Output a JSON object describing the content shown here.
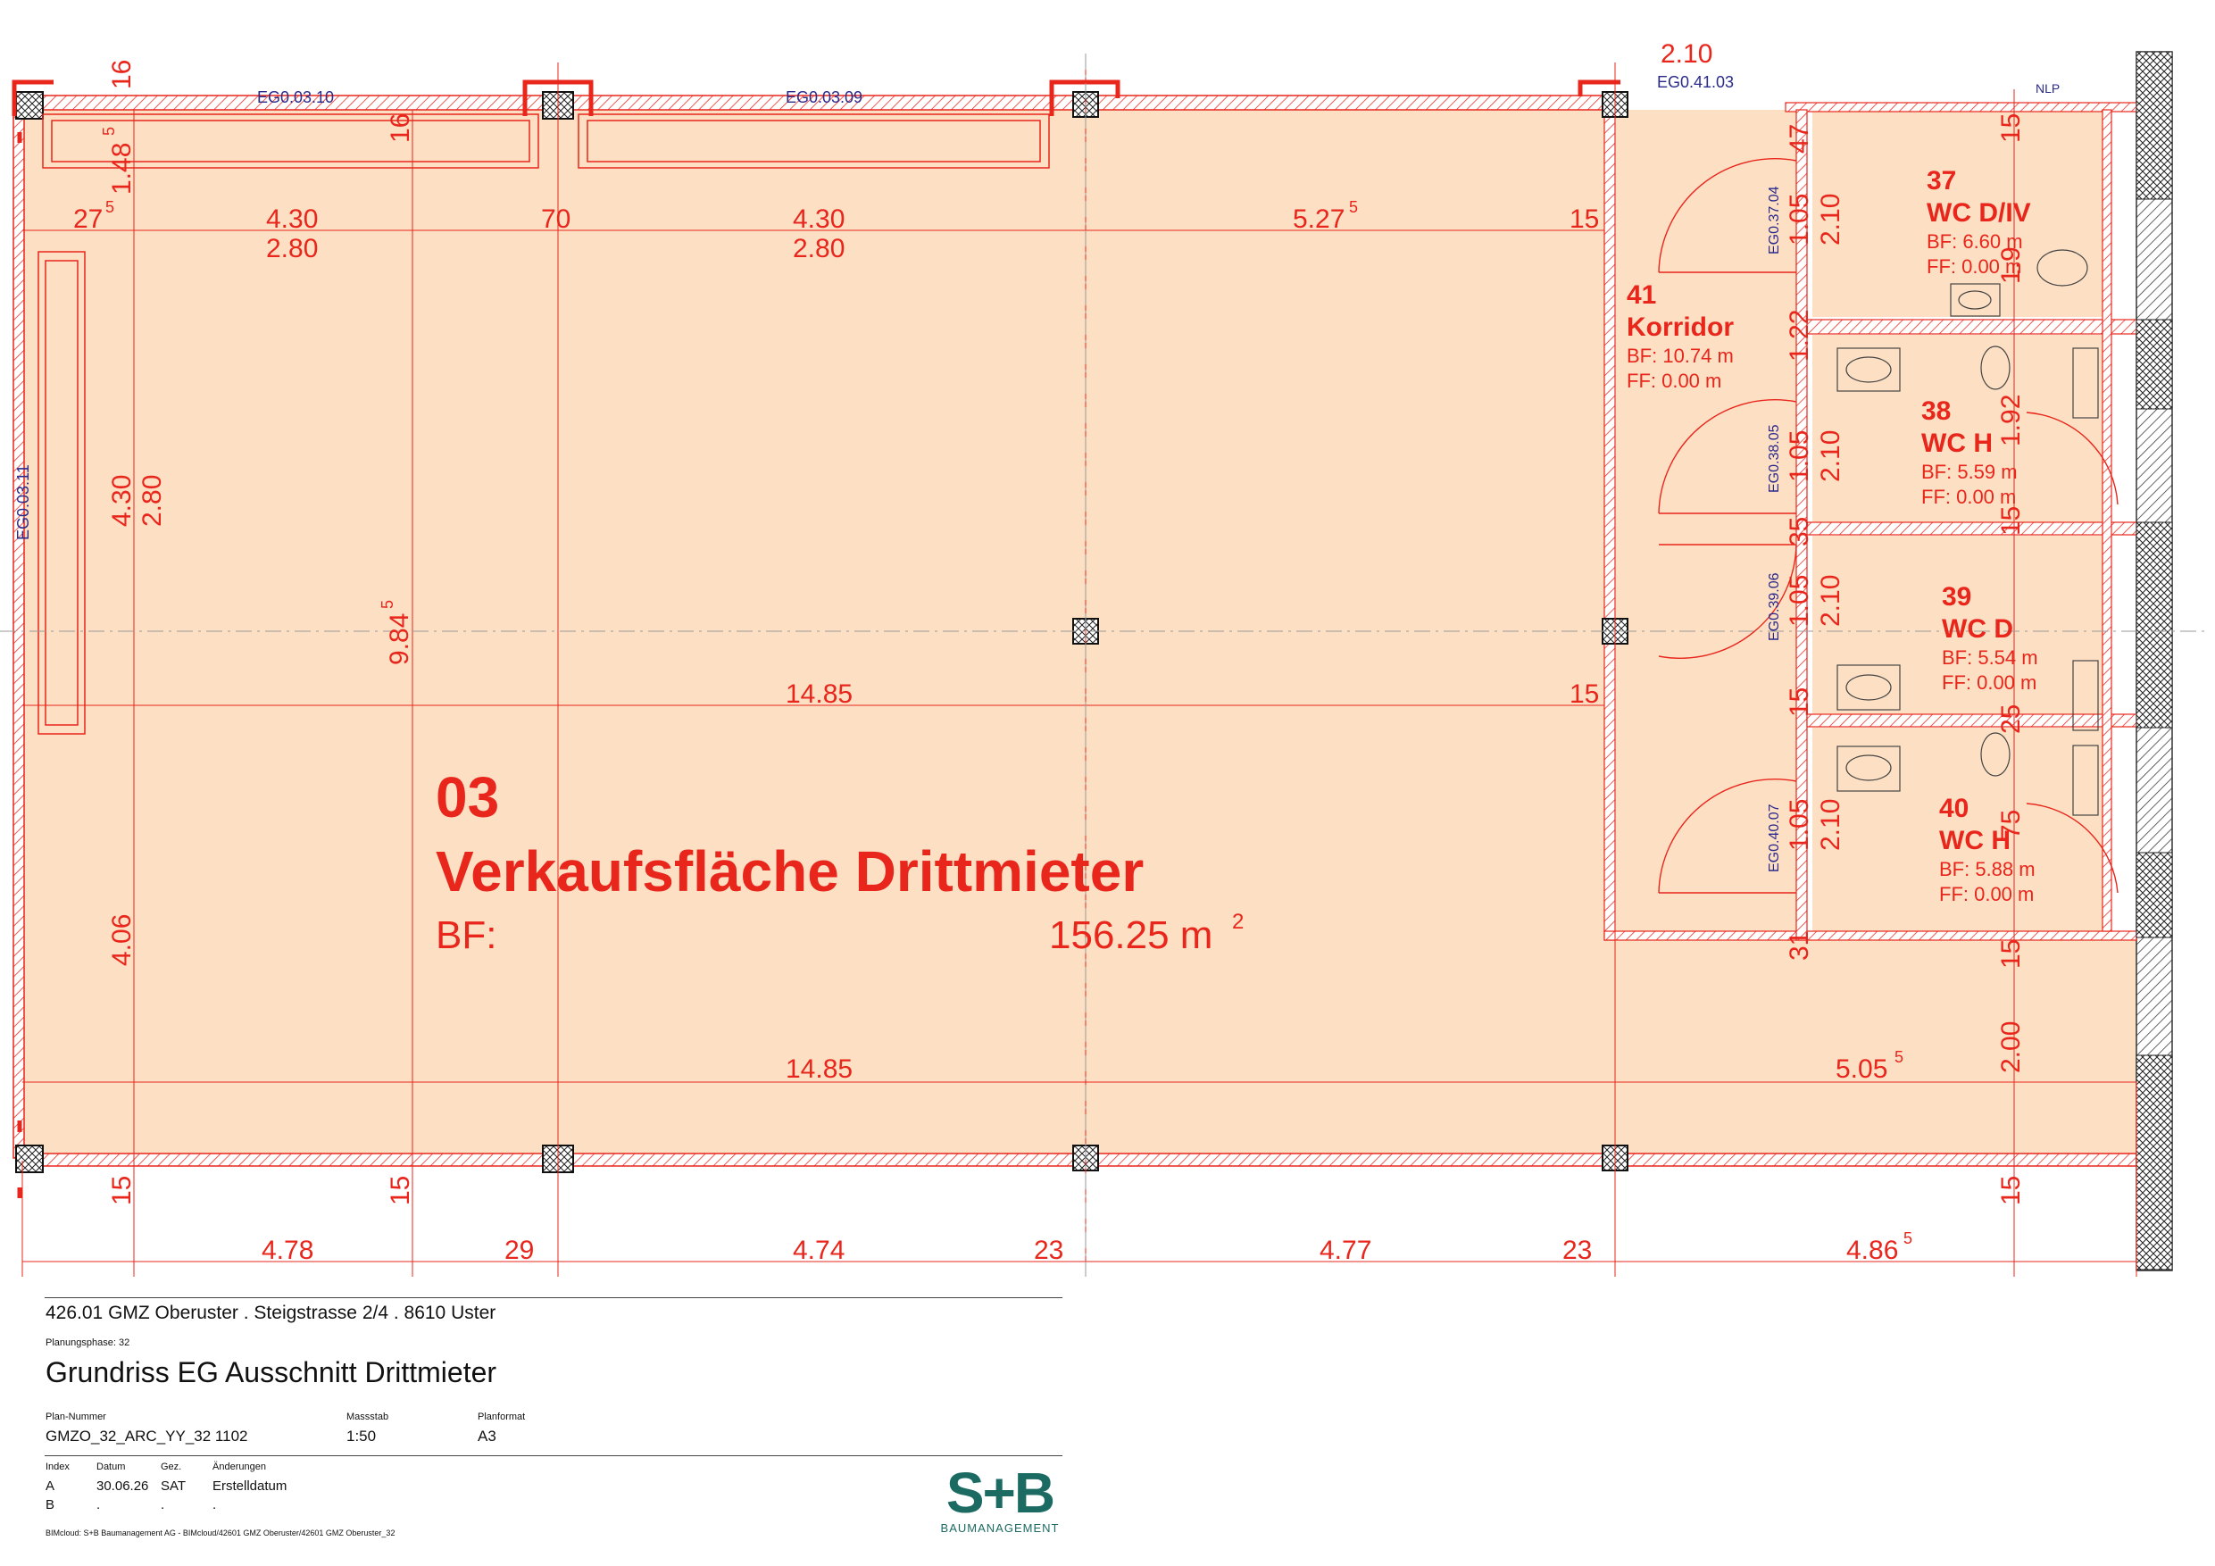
{
  "room_main": {
    "number": "03",
    "name": "Verkaufsfläche Drittmieter",
    "area_label": "BF:",
    "area_value": "156.25 m",
    "area_sup": "2"
  },
  "rooms": [
    {
      "number": "37",
      "name": "WC D/IV",
      "bf": "BF: 6.60 m",
      "ff": "FF: 0.00 m"
    },
    {
      "number": "41",
      "name": "Korridor",
      "bf": "BF: 10.74 m",
      "ff": "FF:   0.00 m"
    },
    {
      "number": "38",
      "name": "WC H",
      "bf": "BF: 5.59 m",
      "ff": "FF: 0.00 m"
    },
    {
      "number": "39",
      "name": "WC D",
      "bf": "BF: 5.54 m",
      "ff": "FF: 0.00 m"
    },
    {
      "number": "40",
      "name": "WC H",
      "bf": "BF: 5.88 m",
      "ff": "FF: 0.00 m"
    }
  ],
  "windows": [
    "EG0.03.10",
    "EG0.03.09",
    "EG0.41.03",
    "EG0.03.11",
    "NLP"
  ],
  "doors": [
    "EG0.37.04",
    "EG0.38.05",
    "EG0.39.06",
    "EG0.40.07"
  ],
  "dimensions": {
    "top_row": [
      "27",
      "5",
      "4.30",
      "2.80",
      "70",
      "4.30",
      "2.80",
      "5.27",
      "5",
      "15"
    ],
    "middle": [
      "14.85",
      "15",
      "9.84",
      "5"
    ],
    "lower": [
      "14.85",
      "5.05",
      "5"
    ],
    "bottom_row": [
      "4.78",
      "29",
      "4.74",
      "23",
      "4.77",
      "23",
      "4.86",
      "5"
    ],
    "left_col": [
      "4.30",
      "2.80",
      "4.06",
      "1.48",
      "5",
      "16",
      "15"
    ],
    "wc_col": [
      "1.05",
      "2.10",
      "47",
      "1.22",
      "35",
      "15",
      "31",
      "1.92",
      "15",
      "25",
      "75",
      "2.00",
      "15",
      "1.9",
      "2.10",
      "15"
    ]
  },
  "title_block": {
    "project": "426.01 GMZ Oberuster . Steigstrasse 2/4 . 8610 Uster",
    "phase": "Planungsphase: 32",
    "title": "Grundriss EG Ausschnitt Drittmieter",
    "plan_number_label": "Plan-Nummer",
    "plan_number": "GMZO_32_ARC_YY_32 1102",
    "scale_label": "Massstab",
    "scale": "1:50",
    "format_label": "Planformat",
    "format": "A3",
    "col_index": "Index",
    "col_date": "Datum",
    "col_drawn": "Gez.",
    "col_changes": "Änderungen",
    "row_a": {
      "index": "A",
      "date": "30.06.26",
      "drawn": "SAT",
      "change": "Erstelldatum"
    },
    "row_b": {
      "index": "B",
      "date": ".",
      "drawn": ".",
      "change": "."
    },
    "footer_path": "BIMcloud: S+B Baumanagement AG - BIMcloud/42601 GMZ Oberuster/42601 GMZ Oberuster_32"
  },
  "logo": {
    "main": "S+B",
    "sub": "BAUMANAGEMENT"
  },
  "colors": {
    "red": "#e8261c",
    "room_fill": "#fde0c4",
    "blue_text": "#2a2a8c",
    "logo": "#1c6b63"
  }
}
